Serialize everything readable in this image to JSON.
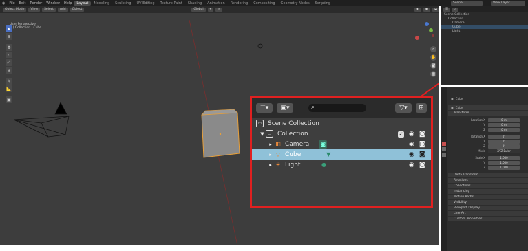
{
  "menu": [
    "File",
    "Edit",
    "Render",
    "Window",
    "Help"
  ],
  "workspaces": [
    "Layout",
    "Modeling",
    "Sculpting",
    "UV Editing",
    "Texture Paint",
    "Shading",
    "Animation",
    "Rendering",
    "Compositing",
    "Geometry Nodes",
    "Scripting"
  ],
  "active_workspace": "Layout",
  "scene_label": "Scene",
  "view_layer_label": "View Layer",
  "viewport": {
    "mode": "Object Mode",
    "view_menus": [
      "View",
      "Select",
      "Add",
      "Object"
    ],
    "orientation": "Global",
    "overlay_title": "User Perspective",
    "overlay_subtitle": "(1) Collection | Cube"
  },
  "outliner_small": {
    "title": "Scene Collection",
    "rows": [
      "Collection",
      "Camera",
      "Cube",
      "Light"
    ]
  },
  "properties": {
    "object_name": "Cube",
    "data_name": "Cube",
    "section_transform": "Transform",
    "location_label": "Location X",
    "rotation_label": "Rotation X",
    "mode_label": "Mode",
    "mode_value": "XYZ Euler",
    "scale_label": "Scale X",
    "loc_values": [
      "0 m",
      "0 m",
      "0 m"
    ],
    "rot_values": [
      "0°",
      "0°",
      "0°"
    ],
    "scale_values": [
      "1.000",
      "1.000",
      "1.000"
    ],
    "sections": [
      "Delta Transform",
      "Relations",
      "Collections",
      "Instancing",
      "Motion Paths",
      "Visibility",
      "Viewport Display",
      "Line Art",
      "Custom Properties"
    ]
  },
  "outliner_zoom": {
    "scene_collection": "Scene Collection",
    "collection": "Collection",
    "items": [
      {
        "label": "Camera",
        "selected": false
      },
      {
        "label": "Cube",
        "selected": true
      },
      {
        "label": "Light",
        "selected": false
      }
    ]
  },
  "colors": {
    "highlight_border": "#e02020",
    "selected_row": "#8fc1d8",
    "cube_outline": "#e8a03a",
    "object_orange": "#e8883a",
    "data_green": "#3aa07a"
  }
}
